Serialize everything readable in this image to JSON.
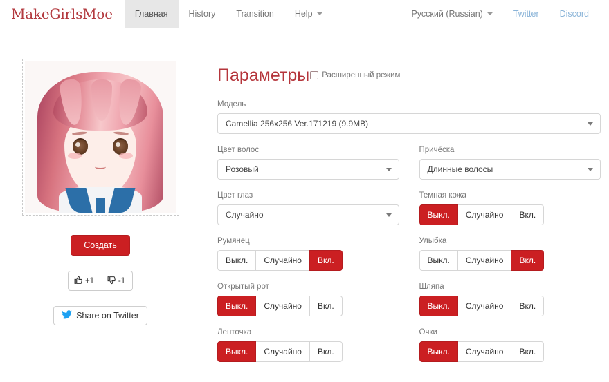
{
  "header": {
    "brand": "MakeGirlsMoe",
    "nav": [
      {
        "label": "Главная",
        "active": true
      },
      {
        "label": "History",
        "active": false
      },
      {
        "label": "Transition",
        "active": false
      },
      {
        "label": "Help",
        "active": false,
        "caret": true
      }
    ],
    "language": "Русский (Russian)",
    "links": [
      {
        "label": "Twitter"
      },
      {
        "label": "Discord"
      }
    ]
  },
  "preview": {
    "alt": "generated-anime-portrait",
    "create_label": "Создать",
    "upvote_label": "+1",
    "downvote_label": "-1",
    "upvote_icon": "thumbs-up-icon",
    "downvote_icon": "thumbs-down-icon",
    "share_label": "Share on Twitter",
    "share_icon": "twitter-bird-icon"
  },
  "options": {
    "title": "Параметры",
    "advanced_label": "Расширенный режим",
    "advanced_checked": false,
    "model": {
      "label": "Модель",
      "value": "Camellia 256x256 Ver.171219 (9.9MB)"
    },
    "selects": [
      {
        "label": "Цвет волос",
        "value": "Розовый"
      },
      {
        "label": "Причёска",
        "value": "Длинные волосы"
      },
      {
        "label": "Цвет глаз",
        "value": "Случайно"
      }
    ],
    "toggle_options": [
      "Выкл.",
      "Случайно",
      "Вкл."
    ],
    "toggles": [
      {
        "label": "Темная кожа",
        "selected": 0
      },
      {
        "label": "Румянец",
        "selected": 2
      },
      {
        "label": "Улыбка",
        "selected": 2
      },
      {
        "label": "Открытый рот",
        "selected": 0
      },
      {
        "label": "Шляпа",
        "selected": 0
      },
      {
        "label": "Ленточка",
        "selected": 0
      },
      {
        "label": "Очки",
        "selected": 0
      }
    ]
  },
  "colors": {
    "accent_red": "#cb1f22",
    "brand_red": "#b33a3f",
    "title_red": "#b5363c",
    "link_blue": "#8ab4d8",
    "twitter_blue": "#1da1f2"
  }
}
